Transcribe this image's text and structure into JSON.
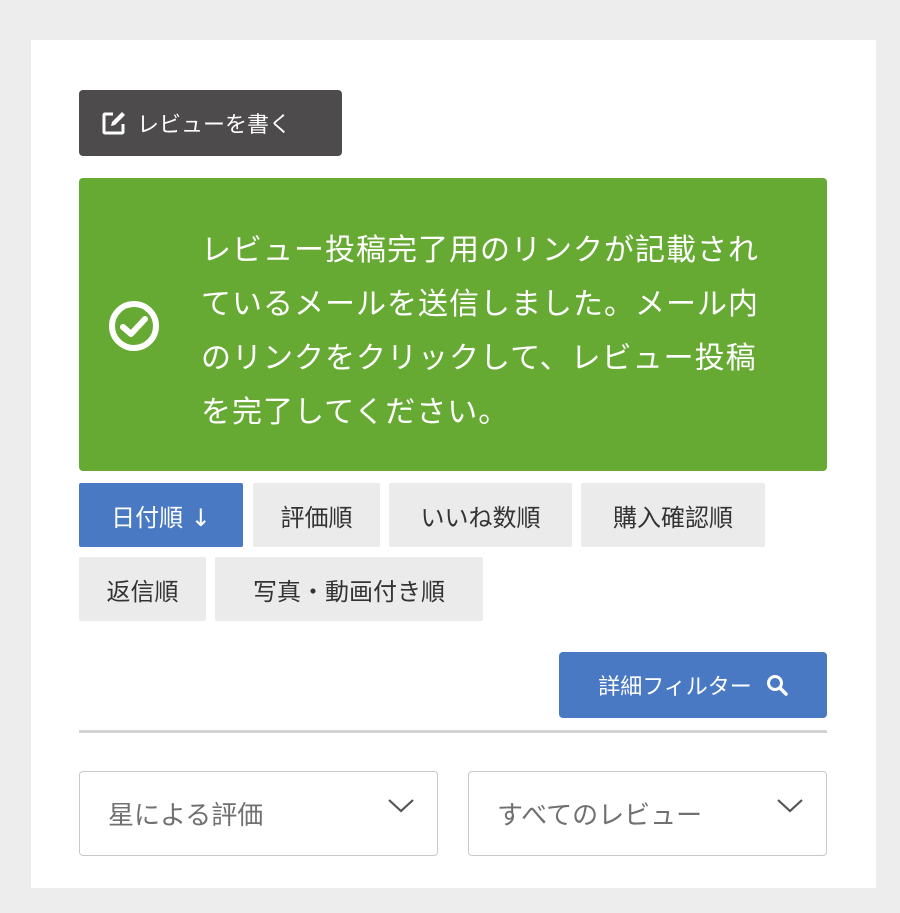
{
  "write_review": {
    "label": "レビューを書く",
    "icon": "edit-icon"
  },
  "alert": {
    "icon": "check-circle-icon",
    "lines": [
      "レビュー投稿完了用のリンクが記載され",
      "ているメールを送信しました。メール内",
      "のリンクをクリックして、レビュー投稿",
      "を完了してください。"
    ],
    "color": "#66aa33"
  },
  "sort_tabs": [
    {
      "label": "日付順 ↓",
      "active": true
    },
    {
      "label": "評価順",
      "active": false
    },
    {
      "label": "いいね数順",
      "active": false
    },
    {
      "label": "購入確認順",
      "active": false
    },
    {
      "label": "返信順",
      "active": false
    },
    {
      "label": "写真・動画付き順",
      "active": false
    }
  ],
  "filter_button": {
    "label": "詳細フィルター",
    "icon": "search-icon"
  },
  "selects": [
    {
      "value": "星による評価",
      "icon": "chevron-down-icon"
    },
    {
      "value": "すべてのレビュー",
      "icon": "chevron-down-icon"
    }
  ],
  "colors": {
    "accent": "#4a79c4",
    "dark_button": "#4d4b4b",
    "success": "#66aa33"
  }
}
